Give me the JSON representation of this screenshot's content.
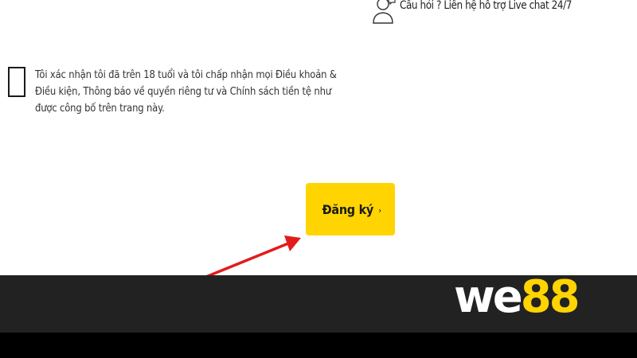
{
  "support": {
    "text": "Câu hỏi ? Liên hệ hỗ trợ Live chat 24/7",
    "icon": "support-agent-icon"
  },
  "terms": {
    "checked": false,
    "text": "Tôi xác nhận tôi đã trên 18 tuổi và tôi chấp nhận mọi Điều khoản & Điều kiện, Thông báo về quyền riêng tư và Chính sách tiền tệ như được công bố trên trang này."
  },
  "register": {
    "label": "Đăng ký",
    "icon": "chevron-right-icon",
    "chevron": "›",
    "color": "#ffd400"
  },
  "annotation": {
    "icon": "arrow-icon",
    "color": "#e31b1b"
  },
  "footer": {
    "logo_part1": "we",
    "logo_part2": "88",
    "logo_color_primary": "#ffffff",
    "logo_color_accent": "#ffd400",
    "band_color": "#222222"
  }
}
